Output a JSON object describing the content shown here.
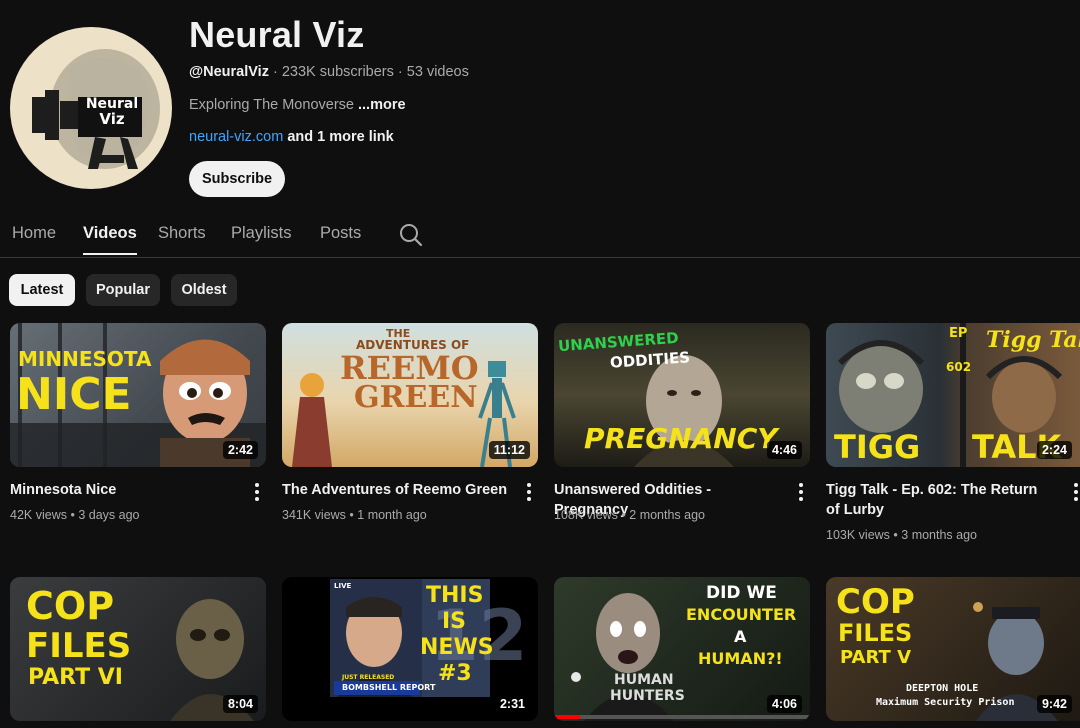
{
  "channel": {
    "name": "Neural Viz",
    "handle": "@NeuralViz",
    "subscribers": "233K subscribers",
    "videos_count": "53 videos",
    "separator": " · ",
    "description": "Exploring The Monoverse",
    "more_label": "...more",
    "link_text": "neural-viz.com",
    "more_links": "and 1 more link",
    "subscribe_label": "Subscribe",
    "avatar_logo": [
      "Neural",
      "Viz"
    ]
  },
  "tabs": [
    {
      "label": "Home",
      "active": false
    },
    {
      "label": "Videos",
      "active": true
    },
    {
      "label": "Shorts",
      "active": false
    },
    {
      "label": "Playlists",
      "active": false
    },
    {
      "label": "Posts",
      "active": false
    }
  ],
  "chips": [
    {
      "label": "Latest",
      "active": true
    },
    {
      "label": "Popular",
      "active": false
    },
    {
      "label": "Oldest",
      "active": false
    }
  ],
  "videos": [
    {
      "title": "Minnesota Nice",
      "views": "42K views",
      "age": "3 days ago",
      "duration": "2:42",
      "thumb_text": [
        "MINNESOTA",
        "NICE"
      ]
    },
    {
      "title": "The Adventures of Reemo Green",
      "views": "341K views",
      "age": "1 month ago",
      "duration": "11:12",
      "thumb_text": [
        "THE",
        "ADVENTURES OF",
        "REEMO",
        "GREEN"
      ]
    },
    {
      "title": "Unanswered Oddities - Pregnancy",
      "views": "108K views",
      "age": "2 months ago",
      "duration": "4:46",
      "thumb_text": [
        "UNANSWERED",
        "ODDITIES",
        "PREGNANCY"
      ]
    },
    {
      "title": "Tigg Talk - Ep. 602: The Return of Lurby",
      "views": "103K views",
      "age": "3 months ago",
      "duration": "2:24",
      "thumb_text": [
        "EP",
        "602",
        "Tigg Talk",
        "TIGG",
        "TALK"
      ]
    },
    {
      "title": "",
      "views": "",
      "age": "",
      "duration": "8:04",
      "thumb_text": [
        "COP",
        "FILES",
        "PART VI"
      ]
    },
    {
      "title": "",
      "views": "",
      "age": "",
      "duration": "2:31",
      "thumb_text": [
        "THIS",
        "IS",
        "NEWS",
        "#3",
        "12",
        "LIVE",
        "JUST RELEASED",
        "BOMBSHELL REPORT"
      ]
    },
    {
      "title": "",
      "views": "",
      "age": "",
      "duration": "4:06",
      "thumb_text": [
        "DID WE",
        "ENCOUNTER",
        "A",
        "HUMAN?!",
        "HUMAN",
        "HUNTERS"
      ]
    },
    {
      "title": "",
      "views": "",
      "age": "",
      "duration": "9:42",
      "thumb_text": [
        "COP",
        "FILES",
        "PART V",
        "DEEPTON HOLE",
        "Maximum Security Prison"
      ]
    }
  ],
  "colors": {
    "background": "#0f0f0f",
    "link": "#3ea6ff",
    "thumb_yellow": "#f5e21a",
    "thumb_green": "#2fd04b"
  }
}
